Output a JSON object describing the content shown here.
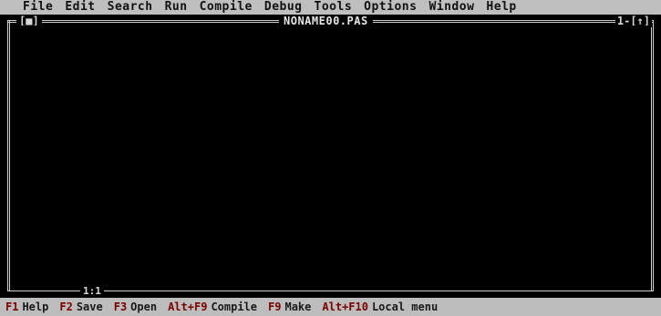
{
  "menu": {
    "items": [
      "File",
      "Edit",
      "Search",
      "Run",
      "Compile",
      "Debug",
      "Tools",
      "Options",
      "Window",
      "Help"
    ]
  },
  "window": {
    "close_box": "[■]",
    "title": "NONAME00.PAS",
    "number": "1-[↑]",
    "cursor_position": "1:1"
  },
  "status": {
    "items": [
      {
        "key": "F1",
        "label": "Help"
      },
      {
        "key": "F2",
        "label": "Save"
      },
      {
        "key": "F3",
        "label": "Open"
      },
      {
        "key": "Alt+F9",
        "label": "Compile"
      },
      {
        "key": "F9",
        "label": "Make"
      },
      {
        "key": "Alt+F10",
        "label": "Local menu"
      }
    ]
  },
  "colors": {
    "menubar_bg": "#bfbfbf",
    "editor_bg": "#000000",
    "frame": "#cfcfcf",
    "status_key": "#7a0000"
  }
}
